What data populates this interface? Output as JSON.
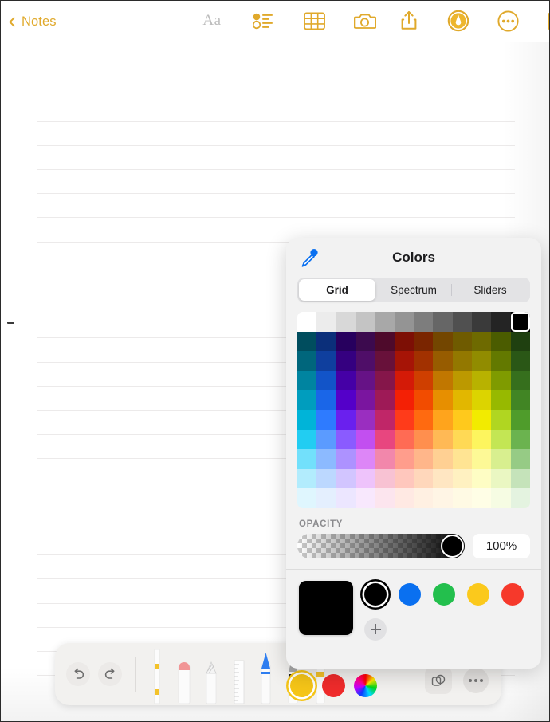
{
  "navbar": {
    "back_label": "Notes",
    "back_icon": "chevron-left-icon",
    "center_icons": [
      {
        "name": "format-text-icon",
        "glyph": "Aa",
        "enabled": false
      },
      {
        "name": "checklist-icon",
        "glyph": "",
        "enabled": true
      },
      {
        "name": "table-icon",
        "glyph": "",
        "enabled": true
      },
      {
        "name": "camera-icon",
        "glyph": "",
        "enabled": true
      }
    ],
    "right_icons": [
      {
        "name": "share-icon",
        "enabled": true
      },
      {
        "name": "markup-pen-icon",
        "enabled": true,
        "active": true
      },
      {
        "name": "more-options-icon",
        "enabled": true
      },
      {
        "name": "compose-icon",
        "enabled": true
      }
    ],
    "accent_color": "#e0a92b"
  },
  "note": {
    "ruled_lines": 27,
    "line_color": "#eceaea",
    "background": "#ffffff"
  },
  "colors_panel": {
    "title": "Colors",
    "eyedropper_icon": "eyedropper-icon",
    "eyedropper_color": "#0a70f0",
    "tabs": [
      {
        "label": "Grid",
        "selected": true
      },
      {
        "label": "Spectrum",
        "selected": false
      },
      {
        "label": "Sliders",
        "selected": false
      }
    ],
    "opacity": {
      "label": "OPACITY",
      "value": "100%",
      "percent": 100
    },
    "preview_color": "#000000",
    "swatches": [
      {
        "name": "black",
        "color": "#000000",
        "selected": true
      },
      {
        "name": "blue",
        "color": "#0a70f0",
        "selected": false
      },
      {
        "name": "green",
        "color": "#23bf4d",
        "selected": false
      },
      {
        "name": "yellow",
        "color": "#fbc91c",
        "selected": false
      },
      {
        "name": "red",
        "color": "#f6392b",
        "selected": false
      }
    ],
    "add_swatch_label": "+",
    "selected_grid_cell": {
      "row": 0,
      "col": 11,
      "color": "#000000"
    },
    "grid": {
      "columns": 12,
      "rows": 10,
      "gray_row": [
        "#ffffff",
        "#ececec",
        "#d8d8d8",
        "#c4c4c4",
        "#a8a8a8",
        "#949494",
        "#7d7d7d",
        "#666666",
        "#505050",
        "#3a3a3a",
        "#242424",
        "#000000"
      ],
      "color_rows": [
        [
          "#004d5e",
          "#0b2f7a",
          "#27005e",
          "#3c0a4e",
          "#4e0a2b",
          "#7d0f05",
          "#7a2500",
          "#734600",
          "#6f5b00",
          "#6e6a00",
          "#4b5c00",
          "#1f4010"
        ],
        [
          "#00667c",
          "#0f3f9e",
          "#350080",
          "#4f0e68",
          "#68113a",
          "#a61406",
          "#a23100",
          "#975c00",
          "#937800",
          "#918c00",
          "#637900",
          "#2a5716"
        ],
        [
          "#0084a0",
          "#1254c8",
          "#4500a6",
          "#661286",
          "#85164a",
          "#d41a07",
          "#cf3f00",
          "#c17700",
          "#bc9900",
          "#b8b200",
          "#7f9b00",
          "#366f1d"
        ],
        [
          "#009dbe",
          "#1a66e8",
          "#5400c9",
          "#7a159f",
          "#9e1a57",
          "#f42005",
          "#f24c00",
          "#e78f00",
          "#e2b700",
          "#dcd400",
          "#97b900",
          "#418524"
        ],
        [
          "#00b4d8",
          "#2e7bff",
          "#6a20ee",
          "#9a2ec0",
          "#c02668",
          "#ff3b1a",
          "#ff6a10",
          "#ffa41c",
          "#ffc91c",
          "#f2eb00",
          "#b0d621",
          "#4f9c2b"
        ],
        [
          "#22cdf2",
          "#5b9bff",
          "#8a5bff",
          "#c24ff0",
          "#e8467f",
          "#ff6b54",
          "#ff8f4e",
          "#ffb955",
          "#ffd955",
          "#fdf55e",
          "#c3e654",
          "#6bb34f"
        ],
        [
          "#72e0fb",
          "#8cbaff",
          "#ad92ff",
          "#dd86f7",
          "#f287ab",
          "#ff9d8c",
          "#ffb68a",
          "#ffd093",
          "#ffe493",
          "#fdf996",
          "#d8ef8f",
          "#96cb85"
        ],
        [
          "#b2ecfd",
          "#bcd8ff",
          "#d2c5ff",
          "#eec3fb",
          "#f8c2d3",
          "#ffc7bd",
          "#ffd7bb",
          "#ffe6c2",
          "#fff1c1",
          "#fefdc4",
          "#eaf7c2",
          "#c5e3ba"
        ],
        [
          "#dff6fe",
          "#e4effe",
          "#ece6ff",
          "#f8e8fd",
          "#fce5ee",
          "#ffe9e3",
          "#fff0e2",
          "#fff5e5",
          "#fffae4",
          "#fffee6",
          "#f6fce3",
          "#e4f3e0"
        ]
      ]
    }
  },
  "draw_toolbar": {
    "undo_icon": "undo-icon",
    "redo_icon": "redo-icon",
    "tools": [
      {
        "name": "marker-tool",
        "color": "#f3c229"
      },
      {
        "name": "eraser-tool",
        "color": "#f19595"
      },
      {
        "name": "pencil-tool",
        "color": "#b9b9b9"
      },
      {
        "name": "ruler-tool",
        "color": "#d6d6d6"
      },
      {
        "name": "pen-tool",
        "color": "#2f7ef0"
      },
      {
        "name": "fountain-pen-tool",
        "color": "#9a9a9a"
      },
      {
        "name": "highlighter-tool",
        "color": "#f3c229"
      }
    ],
    "color_dots": [
      {
        "name": "yellow-dot",
        "color": "#f5c518",
        "selected": true
      },
      {
        "name": "red-dot",
        "color": "#ef2b2b",
        "selected": false
      },
      {
        "name": "color-wheel",
        "color": "rainbow",
        "selected": false
      }
    ],
    "shapes_icon": "shapes-icon",
    "more_icon": "more-options-icon"
  }
}
